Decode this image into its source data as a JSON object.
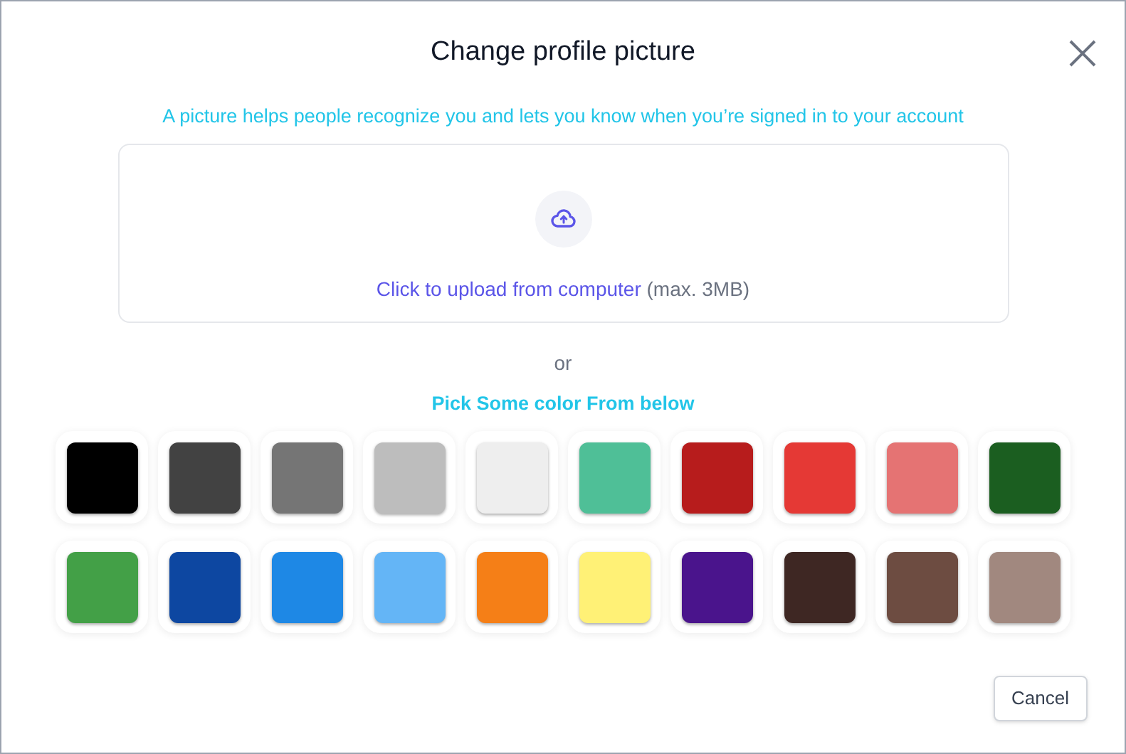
{
  "dialog": {
    "title": "Change profile picture",
    "subtitle": "A picture helps people recognize you and lets you know when you’re signed in to your account"
  },
  "upload": {
    "link": "Click to upload from computer",
    "hint": "(max. 3MB)"
  },
  "separator": "or",
  "palette_title": "Pick Some color From below",
  "colors": [
    {
      "color": "#000000"
    },
    {
      "color": "#424242"
    },
    {
      "color": "#757575"
    },
    {
      "color": "#bdbdbd"
    },
    {
      "color": "#eeeeee"
    },
    {
      "color": "#4fbf97"
    },
    {
      "color": "#b71c1c"
    },
    {
      "color": "#e53935"
    },
    {
      "color": "#e57373"
    },
    {
      "color": "#1b5e20"
    },
    {
      "color": "#43a047"
    },
    {
      "color": "#0d47a1"
    },
    {
      "color": "#1e88e5"
    },
    {
      "color": "#64b5f6"
    },
    {
      "color": "#f57f17"
    },
    {
      "color": "#fff176"
    },
    {
      "color": "#4a148c"
    },
    {
      "color": "#3e2723"
    },
    {
      "color": "#6d4c41"
    },
    {
      "color": "#a1887f"
    }
  ],
  "buttons": [
    "Cancel"
  ]
}
